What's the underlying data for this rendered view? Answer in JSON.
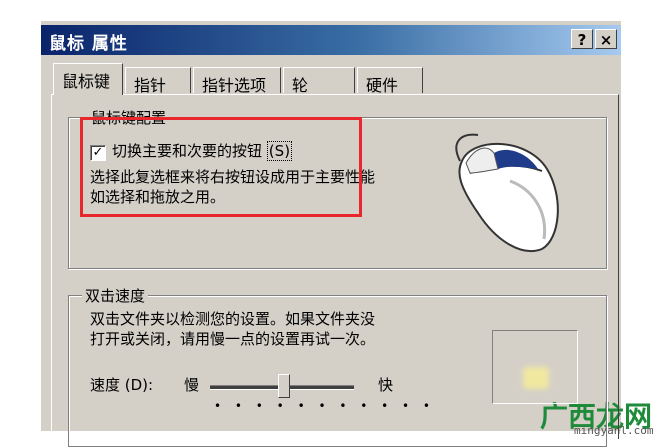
{
  "window": {
    "title": "鼠标 属性",
    "help_label": "?",
    "close_label": "×"
  },
  "tabs": [
    {
      "label": "鼠标键"
    },
    {
      "label": "指针"
    },
    {
      "label": "指针选项"
    },
    {
      "label": "轮"
    },
    {
      "label": "硬件"
    }
  ],
  "button_config": {
    "group_label": "鼠标键配置",
    "checkbox_label": "切换主要和次要的按钮",
    "checkbox_accel": "S",
    "checkbox_checked": true,
    "description_line1": "选择此复选框来将右按钮设成用于主要性能",
    "description_line2": "如选择和拖放之用。"
  },
  "double_click": {
    "group_label": "双击速度",
    "description_line1": "双击文件夹以检测您的设置。如果文件夹没",
    "description_line2": "打开或关闭，请用慢一点的设置再试一次。",
    "speed_label": "速度 (D):",
    "slow_label": "慢",
    "fast_label": "快",
    "slider_value": 0.5,
    "tick_marks": "• • • • • • • • • • •"
  },
  "watermark": {
    "text": "广西龙网",
    "url": "mingyanl.com"
  },
  "colors": {
    "highlight_box": "#e8262b",
    "titlebar": "#0a246a"
  }
}
